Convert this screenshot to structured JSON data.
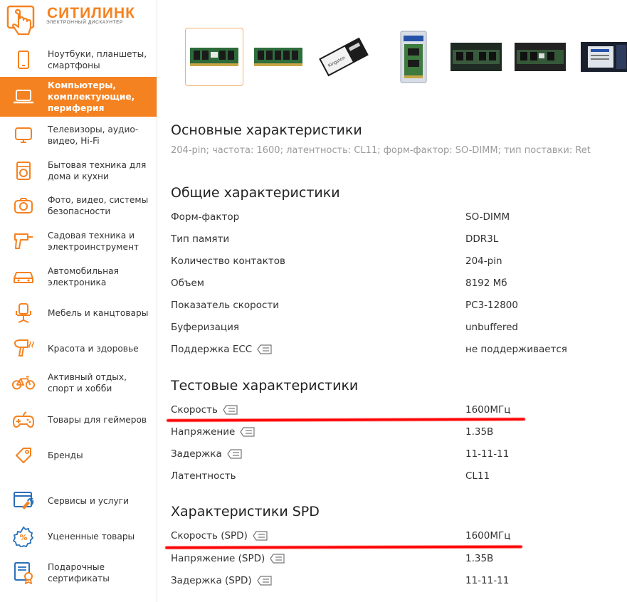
{
  "brand": {
    "name": "СИТИЛИНК",
    "tagline": "ЭЛЕКТРОННЫЙ ДИСКАУНТЕР",
    "accent": "#f58220"
  },
  "sidebar": {
    "items": [
      {
        "label": "Ноутбуки, планшеты, смартфоны",
        "icon": "smartphone-icon"
      },
      {
        "label": "Компьютеры, комплектующие, периферия",
        "icon": "laptop-icon",
        "active": true
      },
      {
        "label": "Телевизоры, аудио-видео, Hi-Fi",
        "icon": "tv-icon"
      },
      {
        "label": "Бытовая техника для дома и кухни",
        "icon": "washing-machine-icon"
      },
      {
        "label": "Фото, видео, системы безопасности",
        "icon": "camera-icon"
      },
      {
        "label": "Садовая техника и электроинструмент",
        "icon": "drill-icon"
      },
      {
        "label": "Автомобильная электроника",
        "icon": "car-icon"
      },
      {
        "label": "Мебель и канцтовары",
        "icon": "office-chair-icon"
      },
      {
        "label": "Красота и здоровье",
        "icon": "hair-dryer-icon"
      },
      {
        "label": "Активный отдых, спорт и хобби",
        "icon": "bicycle-icon"
      },
      {
        "label": "Товары для геймеров",
        "icon": "gamepad-icon"
      },
      {
        "label": "Бренды",
        "icon": "tag-icon"
      },
      {
        "label": "Сервисы и услуги",
        "icon": "services-icon"
      },
      {
        "label": "Уцененные товары",
        "icon": "discount-icon"
      },
      {
        "label": "Подарочные сертификаты",
        "icon": "certificate-icon"
      }
    ]
  },
  "gallery": {
    "thumbnails": [
      "ram-module-front",
      "ram-module-back",
      "kingston-box",
      "ram-retail-pack",
      "ram-photo-dark-1",
      "ram-photo-dark-2",
      "ram-photo-label"
    ],
    "selected_index": 0
  },
  "specs": {
    "main": {
      "title": "Основные характеристики",
      "summary": "204-pin; частота: 1600; латентность: CL11; форм-фактор: SO-DIMM; тип поставки: Ret"
    },
    "general": {
      "title": "Общие характеристики",
      "rows": [
        {
          "key": "Форм-фактор",
          "value": "SO-DIMM",
          "info": false
        },
        {
          "key": "Тип памяти",
          "value": "DDR3L",
          "info": false
        },
        {
          "key": "Количество контактов",
          "value": "204-pin",
          "info": false
        },
        {
          "key": "Объем",
          "value": "8192 Мб",
          "info": false
        },
        {
          "key": "Показатель скорости",
          "value": "PC3-12800",
          "info": false
        },
        {
          "key": "Буферизация",
          "value": "unbuffered",
          "info": false
        },
        {
          "key": "Поддержка ECC",
          "value": "не поддерживается",
          "info": true
        }
      ]
    },
    "test": {
      "title": "Тестовые характеристики",
      "rows": [
        {
          "key": "Скорость",
          "value": "1600МГц",
          "info": true
        },
        {
          "key": "Напряжение",
          "value": "1.35В",
          "info": true
        },
        {
          "key": "Задержка",
          "value": "11-11-11",
          "info": true
        },
        {
          "key": "Латентность",
          "value": "CL11",
          "info": false
        }
      ]
    },
    "spd": {
      "title": "Характеристики SPD",
      "rows": [
        {
          "key": "Скорость (SPD)",
          "value": "1600МГц",
          "info": true
        },
        {
          "key": "Напряжение (SPD)",
          "value": "1.35В",
          "info": true
        },
        {
          "key": "Задержка (SPD)",
          "value": "11-11-11",
          "info": true
        }
      ]
    }
  },
  "annotation_color": "#ff0000"
}
